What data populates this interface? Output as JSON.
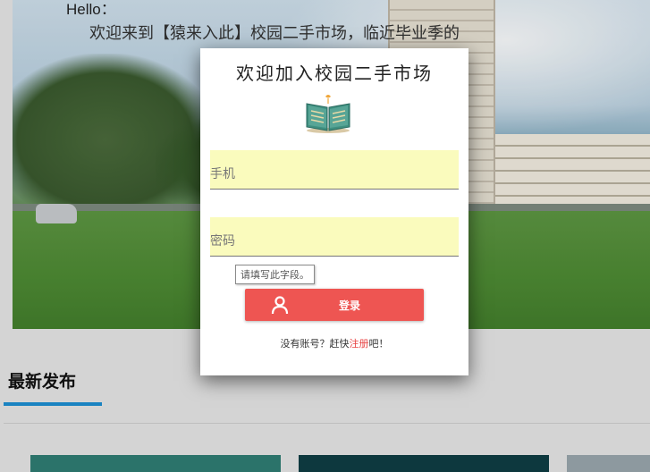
{
  "hero": {
    "hello": "Hello：",
    "welcome": "欢迎来到【猿来入此】校园二手市场，临近毕业季的"
  },
  "section": {
    "title": "最新发布"
  },
  "modal": {
    "title": "欢迎加入校园二手市场",
    "phone_placeholder": "手机",
    "password_placeholder": "密码",
    "tooltip": "请填写此字段。",
    "login_label": "登录",
    "register_prefix": "没有账号？赶快",
    "register_link": "注册",
    "register_suffix": "吧！"
  },
  "icons": {
    "book": "book-icon",
    "user": "user-icon"
  },
  "colors": {
    "login_button": "#ee5552",
    "input_background": "#fafbbd",
    "register_link": "#e84545",
    "section_underline": "#1d8fd2"
  }
}
